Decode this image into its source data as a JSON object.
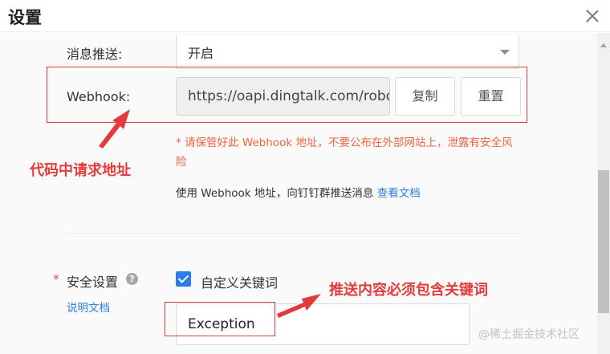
{
  "dialog": {
    "title": "设置"
  },
  "fields": {
    "message_push": {
      "label": "消息推送:",
      "value": "开启"
    },
    "webhook": {
      "label": "Webhook:",
      "url": "https://oapi.dingtalk.com/robot/send?access_token=",
      "copy_label": "复制",
      "reset_label": "重置"
    },
    "warning": "* 请保管好此 Webhook 地址，不要公布在外部网站上，泄露有安全风险",
    "usage": {
      "text": "使用 Webhook 地址，向钉钉群推送消息",
      "link": "查看文档"
    },
    "security": {
      "required_mark": "*",
      "label": "安全设置",
      "help_icon": "question-circle-icon",
      "doc_link": "说明文档",
      "checkbox_label": "自定义关键词",
      "checked": true,
      "keyword_value": "Exception"
    }
  },
  "annotations": {
    "webhook_note": "代码中请求地址",
    "keyword_note": "推送内容必须包含关键词",
    "color": "#e23b3b"
  },
  "watermark": "@稀土掘金技术社区",
  "colors": {
    "link": "#2d7fe0",
    "warning": "#f0643f",
    "checkbox": "#2b7de9"
  }
}
